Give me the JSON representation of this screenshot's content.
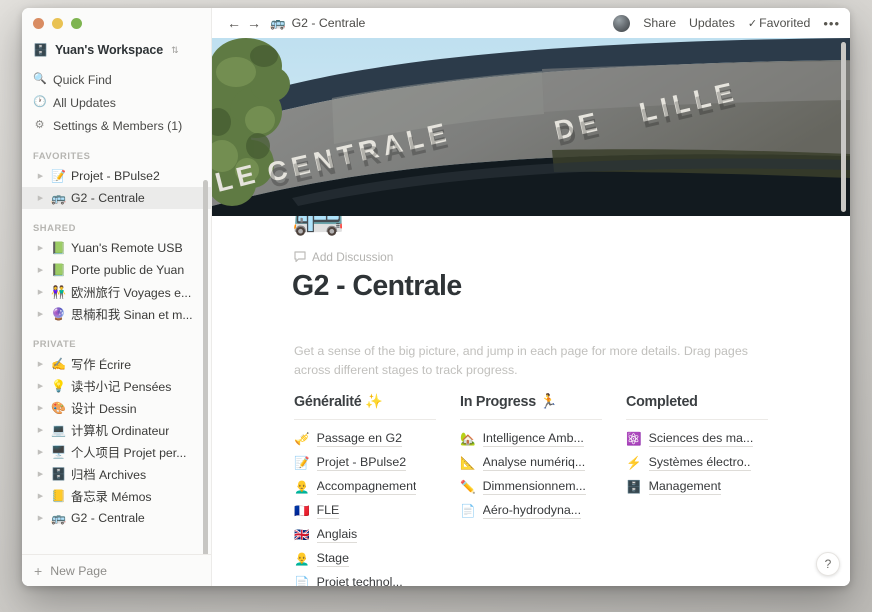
{
  "window": {
    "traffic_lights": [
      "close",
      "minimize",
      "zoom"
    ]
  },
  "sidebar": {
    "workspace": {
      "emoji": "🗄️",
      "name": "Yuan's Workspace",
      "chevron": "⇅"
    },
    "nav": [
      {
        "icon": "🔍",
        "glyph": "search-icon",
        "label": "Quick Find"
      },
      {
        "icon": "🕐",
        "glyph": "clock-icon",
        "label": "All Updates"
      },
      {
        "icon": "⚙",
        "glyph": "gear-icon",
        "label": "Settings & Members (1)"
      }
    ],
    "sections": [
      {
        "title": "FAVORITES",
        "items": [
          {
            "emoji": "📝",
            "label": "Projet - BPulse2",
            "selected": false
          },
          {
            "emoji": "🚌",
            "label": "G2 - Centrale",
            "selected": true
          }
        ]
      },
      {
        "title": "SHARED",
        "items": [
          {
            "emoji": "📗",
            "label": "Yuan's Remote USB",
            "selected": false
          },
          {
            "emoji": "📗",
            "label": "Porte public de Yuan",
            "selected": false
          },
          {
            "emoji": "👫",
            "label": "欧洲旅行 Voyages e...",
            "selected": false
          },
          {
            "emoji": "🔮",
            "label": "思楠和我 Sinan et m...",
            "selected": false
          }
        ]
      },
      {
        "title": "PRIVATE",
        "items": [
          {
            "emoji": "✍️",
            "label": "写作 Écrire",
            "selected": false
          },
          {
            "emoji": "💡",
            "label": "读书小记 Pensées",
            "selected": false
          },
          {
            "emoji": "🎨",
            "label": "设计 Dessin",
            "selected": false
          },
          {
            "emoji": "💻",
            "label": "计算机 Ordinateur",
            "selected": false
          },
          {
            "emoji": "🖥️",
            "label": "个人项目 Projet per...",
            "selected": false
          },
          {
            "emoji": "🗄️",
            "label": "归档 Archives",
            "selected": false
          },
          {
            "emoji": "📒",
            "label": "备忘录 Mémos",
            "selected": false
          },
          {
            "emoji": "🚌",
            "label": "G2 - Centrale",
            "selected": false
          }
        ]
      }
    ],
    "new_page": {
      "icon": "+",
      "label": "New Page"
    }
  },
  "topbar": {
    "back_icon": "←",
    "forward_icon": "→",
    "breadcrumb": {
      "emoji": "🚌",
      "label": "G2 - Centrale"
    },
    "share_label": "Share",
    "updates_label": "Updates",
    "favorited_label": "Favorited",
    "favorited_check": "✓",
    "more_label": "•••"
  },
  "page": {
    "cover_alt": "École Centrale de Lille building facade",
    "cover_text": "…LE CENTRALE DE LILLE",
    "icon": "🚌",
    "add_discussion": "Add Discussion",
    "title": "G2 - Centrale",
    "blurb": "Get a sense of the big picture, and jump in each page for more details. Drag pages across different stages to track progress."
  },
  "board": {
    "columns": [
      {
        "title": "Généralité",
        "title_emoji": "✨",
        "cards": [
          {
            "emoji": "🎺",
            "label": "Passage en G2"
          },
          {
            "emoji": "📝",
            "label": "Projet - BPulse2"
          },
          {
            "emoji": "👨‍🦲",
            "label": "Accompagnement"
          },
          {
            "emoji": "🇫🇷",
            "label": "FLE"
          },
          {
            "emoji": "🇬🇧",
            "label": "Anglais"
          },
          {
            "emoji": "👨‍🦲",
            "label": "Stage"
          },
          {
            "emoji": "📄",
            "label": "Projet technol..."
          }
        ]
      },
      {
        "title": "In Progress",
        "title_emoji": "🏃",
        "cards": [
          {
            "emoji": "🏡",
            "label": "Intelligence Amb..."
          },
          {
            "emoji": "📐",
            "label": "Analyse numériq..."
          },
          {
            "emoji": "✏️",
            "label": "Dimmensionnem..."
          },
          {
            "emoji": "📄",
            "label": "Aéro-hydrodyna..."
          }
        ]
      },
      {
        "title": "Completed",
        "title_emoji": "",
        "cards": [
          {
            "emoji": "⚛️",
            "label": "Sciences des ma..."
          },
          {
            "emoji": "⚡",
            "label": "Systèmes électro.."
          },
          {
            "emoji": "🗄️",
            "label": "Management"
          }
        ]
      }
    ]
  },
  "help_button": {
    "label": "?"
  }
}
